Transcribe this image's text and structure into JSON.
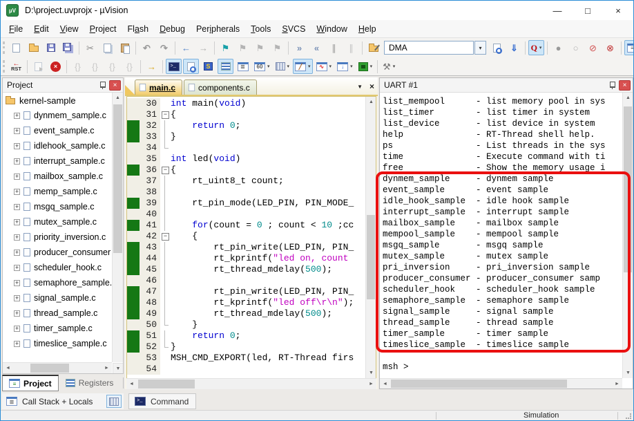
{
  "window": {
    "title": "D:\\project.uvprojx - µVision",
    "logo_text": "µV",
    "controls": {
      "minimize": "—",
      "maximize": "□",
      "close": "×"
    }
  },
  "icons": {
    "close": "×",
    "dropdown": "▾",
    "up": "▲",
    "down": "▼",
    "left": "◄",
    "right": "►",
    "tab_menu": "▼"
  },
  "menu": {
    "items": [
      {
        "label": "File",
        "u": 0
      },
      {
        "label": "Edit",
        "u": 0
      },
      {
        "label": "View",
        "u": 0
      },
      {
        "label": "Project",
        "u": 0
      },
      {
        "label": "Flash",
        "u": 2
      },
      {
        "label": "Debug",
        "u": 0
      },
      {
        "label": "Peripherals",
        "u": 3
      },
      {
        "label": "Tools",
        "u": 0
      },
      {
        "label": "SVCS",
        "u": 0
      },
      {
        "label": "Window",
        "u": 0
      },
      {
        "label": "Help",
        "u": 0
      }
    ]
  },
  "toolbar_main": {
    "dma_combo_value": "DMA",
    "items": [
      {
        "name": "new-file-icon",
        "icon": "page"
      },
      {
        "name": "open-folder-icon",
        "icon": "folder"
      },
      {
        "name": "save-icon",
        "icon": "floppy"
      },
      {
        "name": "save-all-icon",
        "icon": "floppy2"
      },
      {
        "sep": true
      },
      {
        "name": "cut-icon",
        "glyph": "✂",
        "color": "#8a8a8a"
      },
      {
        "name": "copy-icon",
        "icon": "copy"
      },
      {
        "name": "paste-icon",
        "icon": "paste"
      },
      {
        "sep": true
      },
      {
        "name": "undo-icon",
        "glyph": "↶",
        "color": "#9a9a9a",
        "bold": true
      },
      {
        "name": "redo-icon",
        "glyph": "↷",
        "color": "#9a9a9a",
        "bold": true
      },
      {
        "sep": true
      },
      {
        "name": "navigate-back-icon",
        "glyph": "←",
        "color": "#4f81c8",
        "bold": true
      },
      {
        "name": "navigate-forward-icon",
        "glyph": "→",
        "color": "#b0b0b0",
        "bold": true
      },
      {
        "sep": true
      },
      {
        "name": "bookmark-toggle-icon",
        "glyph": "⚑",
        "color": "#18a0a8"
      },
      {
        "name": "bookmark-prev-icon",
        "glyph": "⚑",
        "color": "#b4b4b4"
      },
      {
        "name": "bookmark-next-icon",
        "glyph": "⚑",
        "color": "#b4b4b4"
      },
      {
        "name": "bookmark-clear-icon",
        "glyph": "⚑",
        "color": "#b4b4b4"
      },
      {
        "sep": true
      },
      {
        "name": "indent-icon",
        "glyph": "»",
        "color": "#7d94b8",
        "bold": true
      },
      {
        "name": "outdent-icon",
        "glyph": "«",
        "color": "#7d94b8",
        "bold": true
      },
      {
        "name": "comment-icon",
        "glyph": "∥",
        "color": "#9a9a9a"
      },
      {
        "name": "uncomment-icon",
        "glyph": "∥",
        "color": "#c4c4c4"
      },
      {
        "sep": true
      },
      {
        "name": "find-in-files-icon",
        "icon": "folderpen"
      },
      {
        "combo": true,
        "name": "dma-combo"
      },
      {
        "cdd": true,
        "name": "dma-combo-dropdown"
      },
      {
        "name": "find-next-icon",
        "icon": "pagesearch"
      },
      {
        "name": "download-icon",
        "glyph": "⇓",
        "color": "#3a6fd0",
        "bold": true
      },
      {
        "sep": true
      },
      {
        "name": "quick-search-icon",
        "icon": "qsearch",
        "hl": true,
        "dd": true
      },
      {
        "sep": true
      },
      {
        "name": "insert-breakpoint-icon",
        "glyph": "●",
        "color": "#9a9a9a"
      },
      {
        "name": "enable-breakpoint-icon",
        "glyph": "○",
        "color": "#b0b0b0"
      },
      {
        "name": "disable-all-breakpoints-icon",
        "glyph": "⊘",
        "color": "#d05050"
      },
      {
        "name": "kill-all-breakpoints-icon",
        "glyph": "⊗",
        "color": "#c03030"
      },
      {
        "sep": true
      },
      {
        "name": "project-window-toggle-icon",
        "icon": "winlist",
        "hl": true
      }
    ]
  },
  "toolbar_debug": {
    "rst_label": "RST",
    "items": [
      {
        "name": "reset-button",
        "icon": "rst"
      },
      {
        "sep": true
      },
      {
        "name": "run-icon",
        "icon": "pagerun",
        "dim": true
      },
      {
        "name": "stop-icon",
        "icon": "stopx"
      },
      {
        "sep": true
      },
      {
        "name": "step-into-icon",
        "glyph": "{}",
        "color": "#a0a0a0",
        "dim": true
      },
      {
        "name": "step-over-icon",
        "glyph": "{}",
        "color": "#a0a0a0",
        "dim": true
      },
      {
        "name": "step-out-icon",
        "glyph": "{}",
        "color": "#a0a0a0",
        "dim": true
      },
      {
        "name": "run-to-line-icon",
        "glyph": "{}",
        "color": "#a0a0a0",
        "dim": true
      },
      {
        "sep": true
      },
      {
        "name": "show-next-statement-icon",
        "glyph": "→",
        "color": "#d8a820",
        "bold": true
      },
      {
        "sep": true
      },
      {
        "name": "command-window-icon",
        "icon": "wterm",
        "hl": true
      },
      {
        "name": "disassembly-window-icon",
        "icon": "wsearch",
        "hl": true
      },
      {
        "name": "symbol-window-icon",
        "icon": "sbook"
      },
      {
        "name": "registers-window-icon",
        "icon": "wlines",
        "hl": true
      },
      {
        "name": "callstack-window-icon",
        "icon": "wstack"
      },
      {
        "name": "watch-window-icon",
        "icon": "wwatch",
        "dd": true
      },
      {
        "name": "memory-window-icon",
        "icon": "wmem",
        "dd": true
      },
      {
        "name": "serial-window-icon",
        "icon": "wserial",
        "hl": true,
        "dd": true
      },
      {
        "name": "analysis-window-icon",
        "icon": "wwave",
        "dd": true
      },
      {
        "name": "trace-window-icon",
        "icon": "wtrace",
        "dd": true
      },
      {
        "name": "system-viewer-icon",
        "icon": "wchip",
        "dd": true
      },
      {
        "sep": true
      },
      {
        "name": "debug-settings-icon",
        "glyph": "⚒",
        "color": "#777777",
        "dd": true
      }
    ]
  },
  "project_panel": {
    "title": "Project",
    "root": "kernel-sample",
    "files": [
      "dynmem_sample.c",
      "event_sample.c",
      "idlehook_sample.c",
      "interrupt_sample.c",
      "mailbox_sample.c",
      "memp_sample.c",
      "msgq_sample.c",
      "mutex_sample.c",
      "priority_inversion.c",
      "producer_consumer",
      "scheduler_hook.c",
      "semaphore_sample.",
      "signal_sample.c",
      "thread_sample.c",
      "timer_sample.c",
      "timeslice_sample.c"
    ]
  },
  "editor": {
    "tabs": [
      {
        "label": "main.c",
        "active": true
      },
      {
        "label": "components.c",
        "active": false
      }
    ],
    "folds": [
      {
        "s": 31,
        "e": 34
      },
      {
        "s": 36,
        "e": 52
      },
      {
        "s": 42,
        "e": 50
      }
    ],
    "lines": [
      {
        "n": 30,
        "t": [
          [
            "k",
            "int"
          ],
          [
            "p",
            " main("
          ],
          [
            "k",
            "void"
          ],
          [
            "p",
            ")"
          ]
        ]
      },
      {
        "n": 31,
        "t": [
          [
            "p",
            "{"
          ]
        ]
      },
      {
        "n": 32,
        "m": 1,
        "t": [
          [
            "p",
            "    "
          ],
          [
            "k",
            "return"
          ],
          [
            "p",
            " "
          ],
          [
            "n",
            "0"
          ],
          [
            "p",
            ";"
          ]
        ]
      },
      {
        "n": 33,
        "m": 1,
        "t": [
          [
            "p",
            "}"
          ]
        ]
      },
      {
        "n": 34,
        "t": []
      },
      {
        "n": 35,
        "t": [
          [
            "k",
            "int"
          ],
          [
            "p",
            " led("
          ],
          [
            "k",
            "void"
          ],
          [
            "p",
            ")"
          ]
        ]
      },
      {
        "n": 36,
        "m": 1,
        "t": [
          [
            "p",
            "{"
          ]
        ]
      },
      {
        "n": 37,
        "t": [
          [
            "p",
            "    rt_uint8_t count;"
          ]
        ]
      },
      {
        "n": 38,
        "t": []
      },
      {
        "n": 39,
        "m": 1,
        "t": [
          [
            "p",
            "    rt_pin_mode(LED_PIN, PIN_MODE_"
          ]
        ]
      },
      {
        "n": 40,
        "t": []
      },
      {
        "n": 41,
        "m": 1,
        "t": [
          [
            "p",
            "    "
          ],
          [
            "k",
            "for"
          ],
          [
            "p",
            "(count = "
          ],
          [
            "n",
            "0"
          ],
          [
            "p",
            " ; count < "
          ],
          [
            "n",
            "10"
          ],
          [
            "p",
            " ;cc"
          ]
        ]
      },
      {
        "n": 42,
        "t": [
          [
            "p",
            "    {"
          ]
        ]
      },
      {
        "n": 43,
        "m": 1,
        "t": [
          [
            "p",
            "        rt_pin_write(LED_PIN, PIN_"
          ]
        ]
      },
      {
        "n": 44,
        "m": 1,
        "t": [
          [
            "p",
            "        rt_kprintf("
          ],
          [
            "s",
            "\"led on, count"
          ]
        ]
      },
      {
        "n": 45,
        "m": 1,
        "t": [
          [
            "p",
            "        rt_thread_mdelay("
          ],
          [
            "n",
            "500"
          ],
          [
            "p",
            ");"
          ]
        ]
      },
      {
        "n": 46,
        "t": []
      },
      {
        "n": 47,
        "m": 1,
        "t": [
          [
            "p",
            "        rt_pin_write(LED_PIN, PIN_"
          ]
        ]
      },
      {
        "n": 48,
        "m": 1,
        "t": [
          [
            "p",
            "        rt_kprintf("
          ],
          [
            "s",
            "\"led off\\r\\n\""
          ],
          [
            "p",
            ");"
          ]
        ]
      },
      {
        "n": 49,
        "m": 1,
        "t": [
          [
            "p",
            "        rt_thread_mdelay("
          ],
          [
            "n",
            "500"
          ],
          [
            "p",
            ");"
          ]
        ]
      },
      {
        "n": 50,
        "t": [
          [
            "p",
            "    }"
          ]
        ]
      },
      {
        "n": 51,
        "m": 1,
        "t": [
          [
            "p",
            "    "
          ],
          [
            "k",
            "return"
          ],
          [
            "p",
            " "
          ],
          [
            "n",
            "0"
          ],
          [
            "p",
            ";"
          ]
        ]
      },
      {
        "n": 52,
        "m": 1,
        "t": [
          [
            "p",
            "}"
          ]
        ]
      },
      {
        "n": 53,
        "t": [
          [
            "p",
            "MSH_CMD_EXPORT(led, RT-Thread firs"
          ]
        ]
      },
      {
        "n": 54,
        "t": []
      }
    ]
  },
  "uart_panel": {
    "title": "UART #1",
    "prompt": "msh >",
    "lines": [
      {
        "name": "list_mempool",
        "desc": "list memory pool in sys"
      },
      {
        "name": "list_timer",
        "desc": "list timer in system"
      },
      {
        "name": "list_device",
        "desc": "list device in system"
      },
      {
        "name": "help",
        "desc": "RT-Thread shell help."
      },
      {
        "name": "ps",
        "desc": "List threads in the sys"
      },
      {
        "name": "time",
        "desc": "Execute command with ti"
      },
      {
        "name": "free",
        "desc": "Show the memory usage i"
      },
      {
        "name": "dynmem_sample",
        "desc": "dynmem sample"
      },
      {
        "name": "event_sample",
        "desc": "event sample"
      },
      {
        "name": "idle_hook_sample",
        "desc": "idle hook sample"
      },
      {
        "name": "interrupt_sample",
        "desc": "interrupt sample"
      },
      {
        "name": "mailbox_sample",
        "desc": "mailbox sample"
      },
      {
        "name": "mempool_sample",
        "desc": "mempool sample"
      },
      {
        "name": "msgq_sample",
        "desc": "msgq sample"
      },
      {
        "name": "mutex_sample",
        "desc": "mutex sample"
      },
      {
        "name": "pri_inversion",
        "desc": "pri_inversion sample"
      },
      {
        "name": "producer_consumer",
        "desc": "producer_consumer samp"
      },
      {
        "name": "scheduler_hook",
        "desc": "scheduler_hook sample"
      },
      {
        "name": "semaphore_sample",
        "desc": "semaphore sample"
      },
      {
        "name": "signal_sample",
        "desc": "signal sample"
      },
      {
        "name": "thread_sample",
        "desc": "thread sample"
      },
      {
        "name": "timer_sample",
        "desc": "timer sample"
      },
      {
        "name": "timeslice_sample",
        "desc": "timeslice sample"
      }
    ]
  },
  "bottom_left": {
    "tabs": [
      {
        "label": "Project",
        "active": true,
        "icon": "wchipList"
      },
      {
        "label": "Registers",
        "active": false,
        "icon": "wlines"
      }
    ],
    "callstack_label": "Call Stack + Locals"
  },
  "command_tab": {
    "label": "Command"
  },
  "status_bar": {
    "left": "",
    "simulation": "Simulation"
  },
  "highlight_box": {
    "color": "#ea1010"
  }
}
